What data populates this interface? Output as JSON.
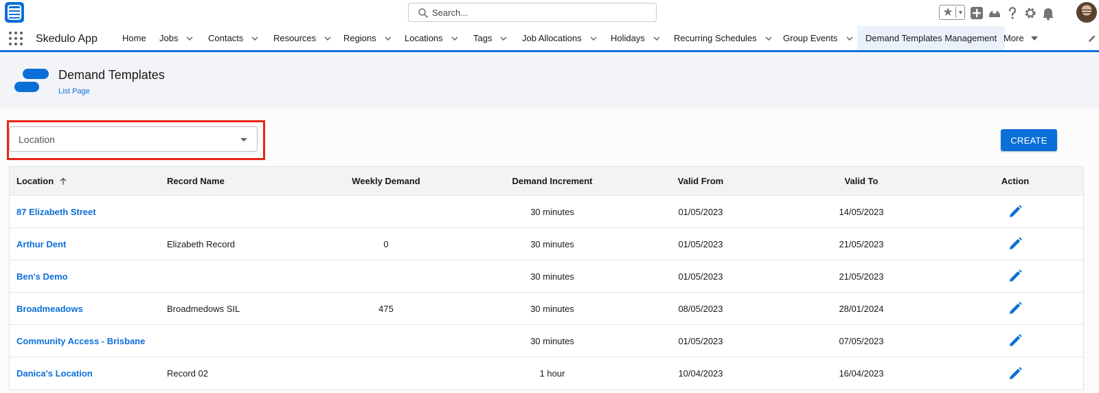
{
  "header": {
    "search_placeholder": "Search..."
  },
  "nav": {
    "app_name": "Skedulo App",
    "items": [
      {
        "label": "Home",
        "chevron": false
      },
      {
        "label": "Jobs",
        "chevron": true
      },
      {
        "label": "Contacts",
        "chevron": true
      },
      {
        "label": "Resources",
        "chevron": true
      },
      {
        "label": "Regions",
        "chevron": true
      },
      {
        "label": "Locations",
        "chevron": true
      },
      {
        "label": "Tags",
        "chevron": true
      },
      {
        "label": "Job Allocations",
        "chevron": true
      },
      {
        "label": "Holidays",
        "chevron": true
      },
      {
        "label": "Recurring Schedules",
        "chevron": true
      },
      {
        "label": "Group Events",
        "chevron": true
      },
      {
        "label": "Demand Templates Management",
        "chevron": false,
        "active": true
      },
      {
        "label": "More",
        "chevron": false
      }
    ]
  },
  "page": {
    "title": "Demand Templates",
    "subtitle": "List Page"
  },
  "filter": {
    "location_value": "Location"
  },
  "actions": {
    "create_label": "CREATE"
  },
  "table": {
    "columns": [
      "Location",
      "Record Name",
      "Weekly Demand",
      "Demand Increment",
      "Valid From",
      "Valid To",
      "Action"
    ],
    "rows": [
      {
        "location": "87 Elizabeth Street",
        "record_name": "",
        "weekly_demand": "",
        "demand_increment": "30 minutes",
        "valid_from": "01/05/2023",
        "valid_to": "14/05/2023"
      },
      {
        "location": "Arthur Dent",
        "record_name": "Elizabeth Record",
        "weekly_demand": "0",
        "demand_increment": "30 minutes",
        "valid_from": "01/05/2023",
        "valid_to": "21/05/2023"
      },
      {
        "location": "Ben's Demo",
        "record_name": "",
        "weekly_demand": "",
        "demand_increment": "30 minutes",
        "valid_from": "01/05/2023",
        "valid_to": "21/05/2023"
      },
      {
        "location": "Broadmeadows",
        "record_name": "Broadmedows SIL",
        "weekly_demand": "475",
        "demand_increment": "30 minutes",
        "valid_from": "08/05/2023",
        "valid_to": "28/01/2024"
      },
      {
        "location": "Community Access - Brisbane",
        "record_name": "",
        "weekly_demand": "",
        "demand_increment": "30 minutes",
        "valid_from": "01/05/2023",
        "valid_to": "07/05/2023"
      },
      {
        "location": "Danica's Location",
        "record_name": "Record 02",
        "weekly_demand": "",
        "demand_increment": "1 hour",
        "valid_from": "10/04/2023",
        "valid_to": "16/04/2023"
      }
    ]
  },
  "colors": {
    "brand": "#0b6fd8",
    "highlight": "#e8231b",
    "page_header_bg": "#f3f4f8"
  }
}
